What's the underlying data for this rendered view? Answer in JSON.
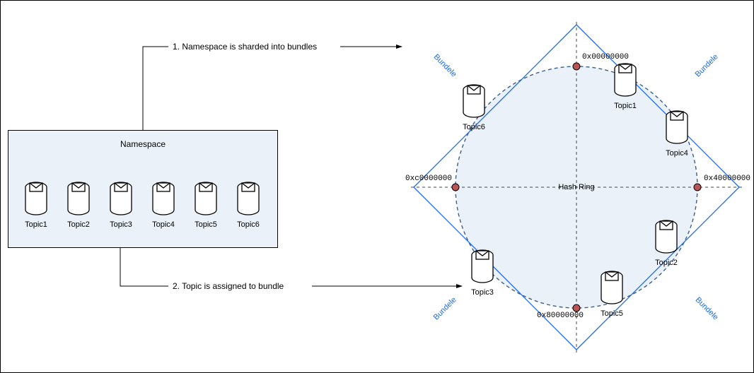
{
  "namespace": {
    "title": "Namespace",
    "topics": [
      "Topic1",
      "Topic2",
      "Topic3",
      "Topic4",
      "Topic5",
      "Topic6"
    ]
  },
  "annotations": {
    "shard": "1. Namespace is sharded into bundles",
    "assign": "2. Topic is assigned to bundle"
  },
  "ring": {
    "label": "Hash Ring",
    "hashes": {
      "top": "0x00000000",
      "right": "0x40000000",
      "bottom": "0x80000000",
      "left": "0xc0000000"
    },
    "bundle_label": "Bundele",
    "topics": {
      "t1": "Topic1",
      "t2": "Topic2",
      "t3": "Topic3",
      "t4": "Topic4",
      "t5": "Topic5",
      "t6": "Topic6"
    }
  }
}
